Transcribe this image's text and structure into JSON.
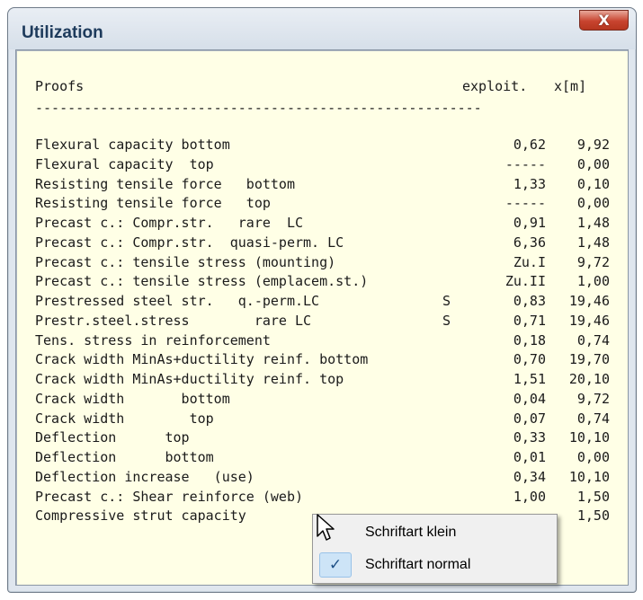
{
  "window": {
    "title": "Utilization",
    "close_label": "X"
  },
  "table": {
    "header": {
      "proofs": "Proofs",
      "exploit": "exploit.",
      "x": "x[m]"
    },
    "separator": "-------------------------------------------------------",
    "rows": [
      {
        "label": "Flexural capacity bottom",
        "flag": "",
        "exploit": "0,62",
        "x": "9,92"
      },
      {
        "label": "Flexural capacity  top",
        "flag": "",
        "exploit": "-----",
        "x": "0,00"
      },
      {
        "label": "Resisting tensile force   bottom",
        "flag": "",
        "exploit": "1,33",
        "x": "0,10"
      },
      {
        "label": "Resisting tensile force   top",
        "flag": "",
        "exploit": "-----",
        "x": "0,00"
      },
      {
        "label": "Precast c.: Compr.str.   rare  LC",
        "flag": "",
        "exploit": "0,91",
        "x": "1,48"
      },
      {
        "label": "Precast c.: Compr.str.  quasi-perm. LC",
        "flag": "",
        "exploit": "6,36",
        "x": "1,48"
      },
      {
        "label": "Precast c.: tensile stress (mounting)",
        "flag": "",
        "exploit": "Zu.I",
        "x": "9,72"
      },
      {
        "label": "Precast c.: tensile stress (emplacem.st.)",
        "flag": "",
        "exploit": "Zu.II",
        "x": "1,00"
      },
      {
        "label": "Prestressed steel str.   q.-perm.LC",
        "flag": "S",
        "exploit": "0,83",
        "x": "19,46"
      },
      {
        "label": "Prestr.steel.stress        rare LC",
        "flag": "S",
        "exploit": "0,71",
        "x": "19,46"
      },
      {
        "label": "Tens. stress in reinforcement",
        "flag": "",
        "exploit": "0,18",
        "x": "0,74"
      },
      {
        "label": "Crack width MinAs+ductility reinf. bottom",
        "flag": "",
        "exploit": "0,70",
        "x": "19,70"
      },
      {
        "label": "Crack width MinAs+ductility reinf. top",
        "flag": "",
        "exploit": "1,51",
        "x": "20,10"
      },
      {
        "label": "Crack width       bottom",
        "flag": "",
        "exploit": "0,04",
        "x": "9,72"
      },
      {
        "label": "Crack width        top",
        "flag": "",
        "exploit": "0,07",
        "x": "0,74"
      },
      {
        "label": "Deflection      top",
        "flag": "",
        "exploit": "0,33",
        "x": "10,10"
      },
      {
        "label": "Deflection      bottom",
        "flag": "",
        "exploit": "0,01",
        "x": "0,00"
      },
      {
        "label": "Deflection increase   (use)",
        "flag": "",
        "exploit": "0,34",
        "x": "10,10"
      },
      {
        "label": "Precast c.: Shear reinforce (web)",
        "flag": "",
        "exploit": "1,00",
        "x": "1,50"
      },
      {
        "label": "Compressive strut capacity",
        "flag": "",
        "exploit": "",
        "x": "1,50"
      }
    ]
  },
  "context_menu": {
    "items": [
      {
        "label": "Schriftart klein",
        "checked": false
      },
      {
        "label": "Schriftart normal",
        "checked": true
      }
    ],
    "check_glyph": "✓"
  },
  "colors": {
    "content_bg": "#ffffe6",
    "title_text": "#1e3b5c",
    "close_button": "#c8442f"
  }
}
